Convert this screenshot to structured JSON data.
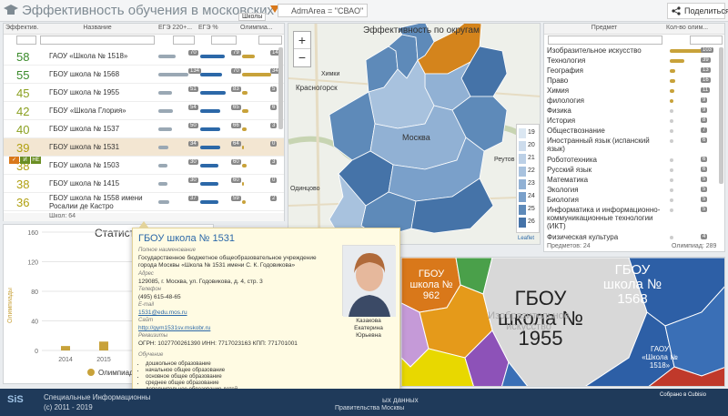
{
  "header": {
    "title": "Эффективность обучения в московских школах",
    "filter": "AdmArea = \"СВАО\"",
    "share_label": "Поделиться"
  },
  "schools_table": {
    "columns": [
      "Эффектив...",
      "Название",
      "ЕГЭ 220+...",
      "ЕГЭ %",
      "Олимпиа..."
    ],
    "hint": "Школы",
    "rows": [
      {
        "score": "58",
        "name": "ГАОУ «Школа № 1518»",
        "c1": "70",
        "c2": "79",
        "c3": "14",
        "color": "#3a8a2a"
      },
      {
        "score": "55",
        "name": "ГБОУ школа № 1568",
        "c1": "134",
        "c2": "70",
        "c3": "34",
        "color": "#3a8a2a"
      },
      {
        "score": "45",
        "name": "ГБОУ школа № 1955",
        "c1": "51",
        "c2": "83",
        "c3": "5",
        "color": "#8aa020"
      },
      {
        "score": "42",
        "name": "ГБОУ «Школа Глория»",
        "c1": "54",
        "c2": "65",
        "c3": "6",
        "color": "#8aa020"
      },
      {
        "score": "40",
        "name": "ГБОУ школа № 1537",
        "c1": "50",
        "c2": "66",
        "c3": "3",
        "color": "#8aa020"
      },
      {
        "score": "39",
        "name": "ГБОУ школа № 1531",
        "c1": "34",
        "c2": "64",
        "c3": "0",
        "color": "#b0a010"
      },
      {
        "score": "38",
        "name": "ГБОУ школа № 1503",
        "c1": "30",
        "c2": "60",
        "c3": "3",
        "color": "#b0a010"
      },
      {
        "score": "38",
        "name": "ГБОУ школа № 1415",
        "c1": "30",
        "c2": "60",
        "c3": "0",
        "color": "#b0a010"
      },
      {
        "score": "36",
        "name": "ГБОУ школа № 1558 имени Росалии де Кастро",
        "c1": "37",
        "c2": "59",
        "c3": "2",
        "color": "#b0a010"
      }
    ],
    "row_actions": [
      "✓",
      "И",
      "НЕ"
    ],
    "footer": "Школ: 64"
  },
  "map": {
    "title": "Эффективность по округам",
    "zoom_in": "+",
    "zoom_out": "−",
    "labels": [
      "Красногорск",
      "Москва",
      "Химки",
      "Одинцово",
      "Реутов"
    ],
    "legend": [
      {
        "value": "19",
        "color": "#dbe7f2"
      },
      {
        "value": "20",
        "color": "#cddcec"
      },
      {
        "value": "21",
        "color": "#bcd0e6"
      },
      {
        "value": "22",
        "color": "#a8c2de"
      },
      {
        "value": "23",
        "color": "#91b1d4"
      },
      {
        "value": "24",
        "color": "#7aa0ca"
      },
      {
        "value": "25",
        "color": "#5e8ab9"
      },
      {
        "value": "26",
        "color": "#4573a8"
      }
    ],
    "attribution": "Leaflet"
  },
  "subjects": {
    "columns": [
      "Предмет",
      "Кол-во олим..."
    ],
    "rows": [
      {
        "name": "Изобразительное искусство",
        "value": "103",
        "frac": 1.0,
        "hl": true
      },
      {
        "name": "Технология",
        "value": "39",
        "frac": 0.4,
        "hl": true
      },
      {
        "name": "География",
        "value": "13",
        "frac": 0.15,
        "hl": true
      },
      {
        "name": "Право",
        "value": "16",
        "frac": 0.16,
        "hl": true
      },
      {
        "name": "Химия",
        "value": "11",
        "frac": 0.12,
        "hl": true
      },
      {
        "name": "филология",
        "value": "9",
        "frac": 0.1,
        "hl": true
      },
      {
        "name": "Физика",
        "value": "9",
        "frac": 0.1,
        "hl": false
      },
      {
        "name": "История",
        "value": "8",
        "frac": 0.09,
        "hl": false
      },
      {
        "name": "Обществознание",
        "value": "7",
        "frac": 0.08,
        "hl": false
      },
      {
        "name": "Иностранный язык (испанский язык)",
        "value": "6",
        "frac": 0.07,
        "hl": false
      },
      {
        "name": "Робототехника",
        "value": "6",
        "frac": 0.07,
        "hl": false
      },
      {
        "name": "Русский язык",
        "value": "6",
        "frac": 0.07,
        "hl": false
      },
      {
        "name": "Математика",
        "value": "5",
        "frac": 0.06,
        "hl": false
      },
      {
        "name": "Экология",
        "value": "5",
        "frac": 0.06,
        "hl": false
      },
      {
        "name": "Биология",
        "value": "5",
        "frac": 0.06,
        "hl": false
      },
      {
        "name": "Информатика и информационно-коммуникационные технологии (ИКТ)",
        "value": "5",
        "frac": 0.06,
        "hl": false
      },
      {
        "name": "Физическая культура",
        "value": "4",
        "frac": 0.05,
        "hl": false
      }
    ],
    "footer_left": "Предметов: 24",
    "footer_right": "Олимпиад: 289"
  },
  "stats": {
    "title": "Статисти",
    "y_axis_label": "Олимпиады",
    "legend": "Олимпиады",
    "ticks_y": [
      "160",
      "120",
      "80",
      "40",
      "0"
    ],
    "ticks_x": [
      "2014",
      "2015"
    ]
  },
  "chart_data": {
    "type": "bar",
    "categories": [
      "2014",
      "2015"
    ],
    "values": [
      6,
      12
    ],
    "title": "Статисти",
    "ylabel": "Олимпиады",
    "ylim": [
      0,
      160
    ]
  },
  "popup": {
    "title": "ГБОУ школа № 1531",
    "full_name_label": "Полное наименование",
    "full_name": "Государственное бюджетное общеобразовательное учреждение города Москвы «Школа № 1531 имени С. К. Годовикова»",
    "address_label": "Адрес",
    "address": "129085, г. Москва, ул. Годовикова, д. 4, стр. 3",
    "phone_label": "Телефон",
    "phone": "(495) 615-48-65",
    "email_label": "E-mail",
    "email": "1531@edu.mos.ru",
    "site_label": "Сайт",
    "site": "http://gym1531sv.mskobr.ru",
    "req_label": "Реквизиты",
    "requisites": "ОГРН: 1027700261390   ИНН: 7717023163   КПП: 771701001",
    "edu_label": "Обучение",
    "education": [
      "дошкольное образование",
      "начальное общее образование",
      "основное общее образование",
      "среднее общее образование",
      "дополнительное образование детей",
      "дополнительное образование взрослых"
    ],
    "director": "Казакова Екатерина Юрьевна"
  },
  "treemap": {
    "cells": [
      {
        "label": "ГБОУ школа № 962",
        "color": "#d9781a"
      },
      {
        "label": "ГБОУ школа № 1955",
        "color": "#d8d8d8"
      },
      {
        "label": "ГБОУ школа № 1568",
        "color": "#2d5fa6"
      },
      {
        "label": "ГАОУ «Школа № 1518»",
        "color": "#2d5fa6"
      }
    ],
    "watermark": "Изобразительное искусство"
  },
  "footer": {
    "logo": "SiS",
    "line1": "Специальные Информационны",
    "line2": "(с) 2011 - 2019",
    "center1": "ых данных",
    "center2": "Правительства Москвы",
    "badge": "Собрано в Cubisio"
  }
}
